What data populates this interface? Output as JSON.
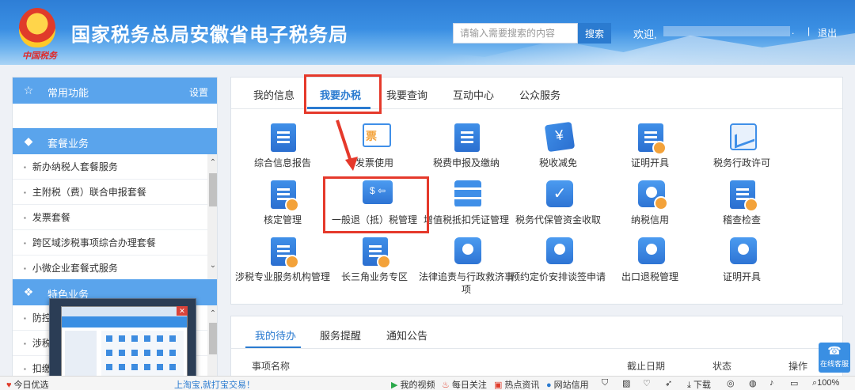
{
  "header": {
    "emblem_script": "中国税务",
    "site_title": "国家税务总局安徽省电子税务局",
    "search_placeholder": "请输入需要搜索的内容",
    "search_button": "搜索",
    "welcome": "欢迎,",
    "dot": ".",
    "separator": "|",
    "logout": "退出"
  },
  "left_panel": {
    "common": {
      "title": "常用功能",
      "settings": "设置"
    },
    "package": {
      "title": "套餐业务",
      "items": [
        "新办纳税人套餐服务",
        "主附税（费）联合申报套餐",
        "发票套餐",
        "跨区域涉税事项综合办理套餐",
        "小微企业套餐式服务"
      ]
    },
    "special": {
      "title": "特色业务",
      "items": [
        "防控",
        "涉税",
        "扣缴"
      ]
    }
  },
  "main_tabs": [
    "我的信息",
    "我要办税",
    "我要查询",
    "互动中心",
    "公众服务"
  ],
  "grid_items": [
    "综合信息报告",
    "发票使用",
    "税费申报及缴纳",
    "税收减免",
    "证明开具",
    "税务行政许可",
    "核定管理",
    "一般退（抵）税管理",
    "增值税抵扣凭证管理",
    "税务代保管资金收取",
    "纳税信用",
    "稽查检查",
    "涉税专业服务机构管理",
    "长三角业务专区",
    "法律追责与行政救济事项",
    "预约定价安排谈签申请",
    "出口退税管理",
    "证明开具"
  ],
  "bottom_panel": {
    "tabs": [
      "我的待办",
      "服务提醒",
      "通知公告"
    ],
    "columns": [
      "事项名称",
      "截止日期",
      "状态",
      "操作"
    ]
  },
  "online_service": "在线客服",
  "status_bar": {
    "left": "今日优选",
    "promo": "上淘宝,就打宝交易！",
    "items": [
      "我的视频",
      "每日关注",
      "热点资讯",
      "网站信用"
    ],
    "download": "下载",
    "zoom": "100%"
  },
  "colors": {
    "accent": "#2b7bd0",
    "highlight_red": "#e5392b",
    "section_blue": "#5aa4ec"
  }
}
